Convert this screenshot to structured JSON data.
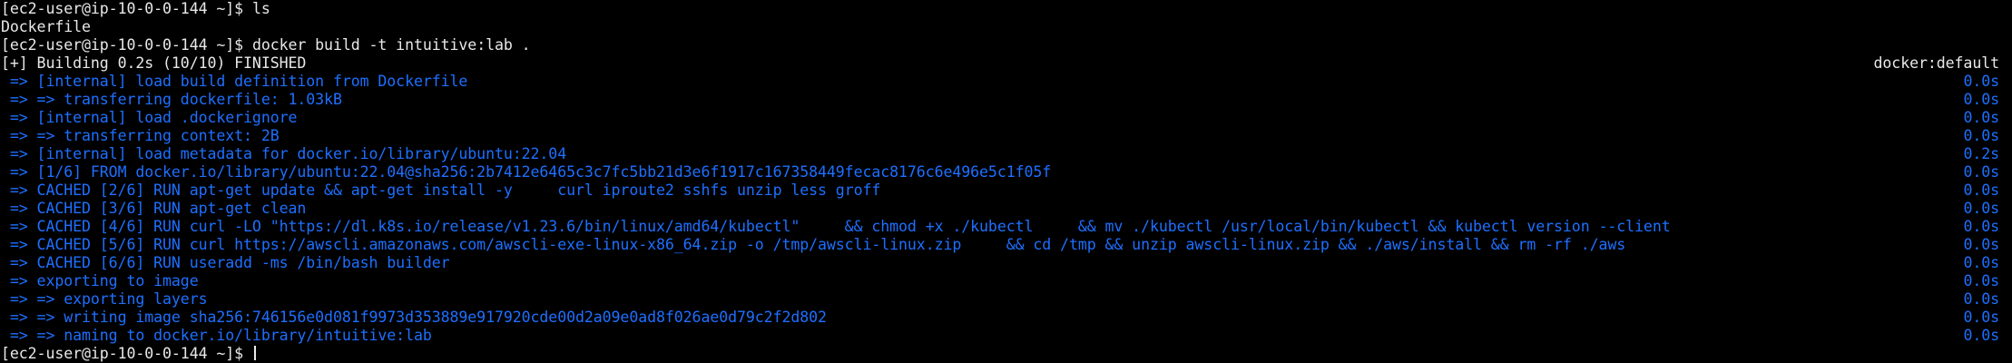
{
  "terminal": {
    "prompt": "[ec2-user@ip-10-0-0-144 ~]$ ",
    "cmd1": "ls",
    "ls_output": "Dockerfile",
    "cmd2": "docker build -t intuitive:lab .",
    "building": "[+] Building 0.2s (10/10) FINISHED",
    "builder": "docker:default",
    "steps": [
      {
        "text": " => [internal] load build definition from Dockerfile",
        "time": "0.0s"
      },
      {
        "text": " => => transferring dockerfile: 1.03kB",
        "time": "0.0s"
      },
      {
        "text": " => [internal] load .dockerignore",
        "time": "0.0s"
      },
      {
        "text": " => => transferring context: 2B",
        "time": "0.0s"
      },
      {
        "text": " => [internal] load metadata for docker.io/library/ubuntu:22.04",
        "time": "0.2s"
      },
      {
        "text": " => [1/6] FROM docker.io/library/ubuntu:22.04@sha256:2b7412e6465c3c7fc5bb21d3e6f1917c167358449fecac8176c6e496e5c1f05f",
        "time": "0.0s"
      },
      {
        "text": " => CACHED [2/6] RUN apt-get update && apt-get install -y     curl iproute2 sshfs unzip less groff",
        "time": "0.0s"
      },
      {
        "text": " => CACHED [3/6] RUN apt-get clean",
        "time": "0.0s"
      },
      {
        "text": " => CACHED [4/6] RUN curl -LO \"https://dl.k8s.io/release/v1.23.6/bin/linux/amd64/kubectl\"     && chmod +x ./kubectl     && mv ./kubectl /usr/local/bin/kubectl && kubectl version --client",
        "time": "0.0s"
      },
      {
        "text": " => CACHED [5/6] RUN curl https://awscli.amazonaws.com/awscli-exe-linux-x86_64.zip -o /tmp/awscli-linux.zip     && cd /tmp && unzip awscli-linux.zip && ./aws/install && rm -rf ./aws",
        "time": "0.0s"
      },
      {
        "text": " => CACHED [6/6] RUN useradd -ms /bin/bash builder",
        "time": "0.0s"
      },
      {
        "text": " => exporting to image",
        "time": "0.0s"
      },
      {
        "text": " => => exporting layers",
        "time": "0.0s"
      },
      {
        "text": " => => writing image sha256:746156e0d081f9973d353889e917920cde00d2a09e0ad8f026ae0d79c2f2d802",
        "time": "0.0s"
      },
      {
        "text": " => => naming to docker.io/library/intuitive:lab",
        "time": "0.0s"
      }
    ],
    "final_prompt": "[ec2-user@ip-10-0-0-144 ~]$ "
  },
  "colors": {
    "background": "#000000",
    "foreground": "#e8e8e8",
    "step_blue": "#1e6fff"
  }
}
